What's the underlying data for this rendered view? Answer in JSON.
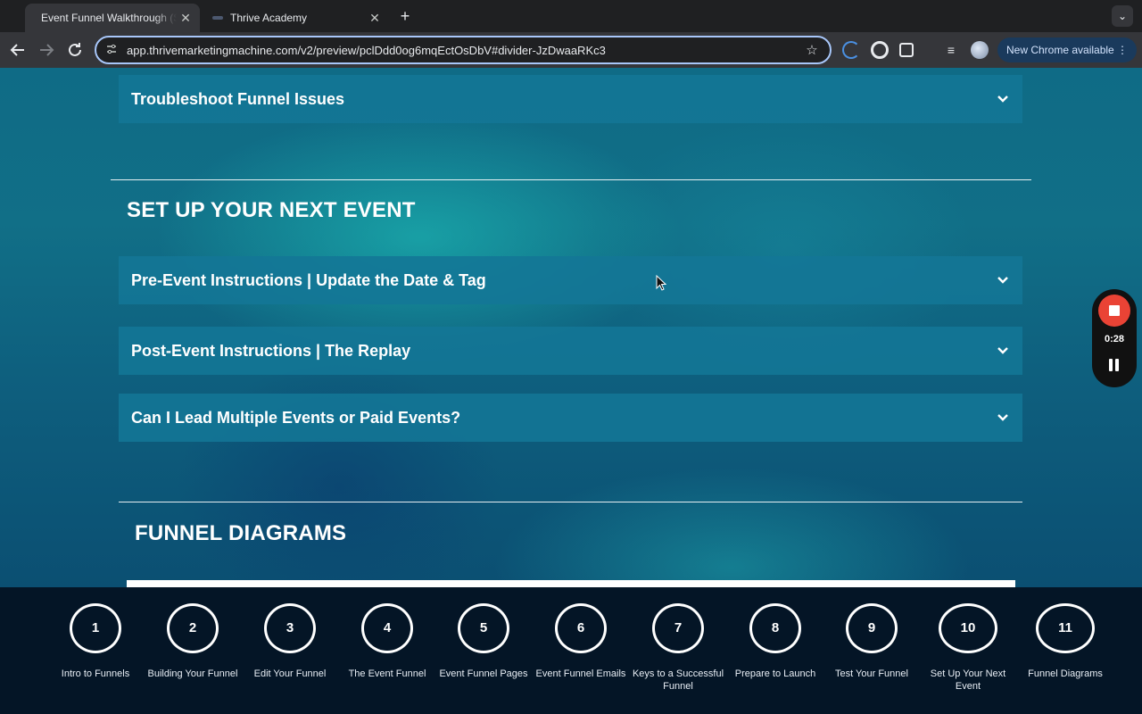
{
  "browser": {
    "tabs": [
      {
        "title": "Event Funnel Walkthrough (S",
        "active": true
      },
      {
        "title": "Thrive Academy",
        "active": false
      }
    ],
    "url": "app.thrivemarketingmachine.com/v2/preview/pclDdd0og6mqEctOsDbV#divider-JzDwaaRKc3",
    "update_label": "New Chrome available",
    "close_glyph": "✕",
    "new_tab_glyph": "+",
    "star_glyph": "☆",
    "menu_glyph": "⌄",
    "more_glyph": "⋮"
  },
  "content": {
    "accordions_top": [
      {
        "label": "Troubleshoot Funnel Issues"
      }
    ],
    "section1_title": "SET UP YOUR NEXT EVENT",
    "accordions": [
      {
        "label": "Pre-Event Instructions | Update the Date & Tag"
      },
      {
        "label": "Post-Event Instructions | The Replay"
      },
      {
        "label": "Can I Lead Multiple Events or Paid Events?"
      }
    ],
    "section2_title": "FUNNEL DIAGRAMS"
  },
  "recorder": {
    "time": "0:28"
  },
  "steps": [
    {
      "num": "1",
      "label": "Intro to Funnels"
    },
    {
      "num": "2",
      "label": "Building Your Funnel"
    },
    {
      "num": "3",
      "label": "Edit Your Funnel"
    },
    {
      "num": "4",
      "label": "The Event Funnel"
    },
    {
      "num": "5",
      "label": "Event Funnel Pages"
    },
    {
      "num": "6",
      "label": "Event Funnel Emails"
    },
    {
      "num": "7",
      "label": "Keys to a Successful Funnel"
    },
    {
      "num": "8",
      "label": "Prepare to Launch"
    },
    {
      "num": "9",
      "label": "Test Your Funnel"
    },
    {
      "num": "10",
      "label": "Set Up Your Next Event"
    },
    {
      "num": "11",
      "label": "Funnel Diagrams"
    }
  ],
  "colors": {
    "accent": "#137696",
    "stepbar": "#041526",
    "record": "#ea4335"
  }
}
